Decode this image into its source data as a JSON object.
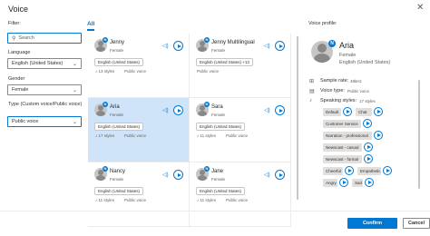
{
  "window": {
    "title": "Voice",
    "close_glyph": "✕"
  },
  "filter": {
    "heading": "Filter:",
    "search_placeholder": "Search",
    "language_label": "Language",
    "language_value": "English (United States)",
    "gender_label": "Gender",
    "gender_value": "Female",
    "type_label": "Type (Custom voice/Public voice)",
    "type_value": "Public voice"
  },
  "tabs": {
    "all": "All"
  },
  "voices": [
    {
      "name": "Jenny",
      "gender": "Female",
      "locale": "English (United States)",
      "styles": "13 styles",
      "type": "Public voice",
      "selected": false
    },
    {
      "name": "Jenny Multilingual",
      "gender": "Female",
      "locale": "English (United States) +13",
      "styles": "",
      "type": "Public voice",
      "selected": false
    },
    {
      "name": "Aria",
      "gender": "Female",
      "locale": "English (United States)",
      "styles": "17 styles",
      "type": "Public voice",
      "selected": true
    },
    {
      "name": "Sara",
      "gender": "Female",
      "locale": "English (United States)",
      "styles": "11 styles",
      "type": "Public voice",
      "selected": false
    },
    {
      "name": "Nancy",
      "gender": "Female",
      "locale": "English (United States)",
      "styles": "11 styles",
      "type": "Public voice",
      "selected": false
    },
    {
      "name": "Jane",
      "gender": "Female",
      "locale": "English (United States)",
      "styles": "11 styles",
      "type": "Public voice",
      "selected": false
    }
  ],
  "profile": {
    "heading": "Voice profile:",
    "name": "Aria",
    "gender": "Female",
    "locale": "English (United States)",
    "sample_rate_label": "Sample rate:",
    "sample_rate_value": "48kHz",
    "voice_type_label": "Voice type:",
    "voice_type_value": "Public voice",
    "speaking_styles_label": "Speaking styles:",
    "speaking_styles_value": "17 styles",
    "styles": [
      "Default",
      "Chat",
      "Customer Service",
      "Narration - professional",
      "Newscast - casual",
      "Newscast - formal",
      "Cheerful",
      "Empathetic",
      "Angry",
      "Sad"
    ]
  },
  "footer": {
    "confirm": "Confirm",
    "cancel": "Cancel"
  },
  "colors": {
    "accent": "#0078d4",
    "selected_card": "#cfe4f8"
  }
}
